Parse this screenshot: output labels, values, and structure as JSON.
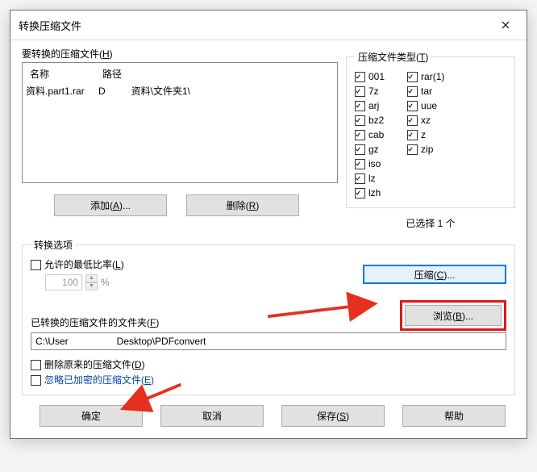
{
  "window": {
    "title": "转换压缩文件",
    "close_icon": "close"
  },
  "files": {
    "legend_pre": "要转换的压缩文件(",
    "legend_hot": "H",
    "legend_post": ")",
    "col_name": "名称",
    "col_path": "路径",
    "rows": [
      {
        "name": "资料.part1.rar",
        "path_pre": "D",
        "path_post": "资料\\文件夹1\\"
      }
    ],
    "add_pre": "添加(",
    "add_hot": "A",
    "add_post": ")...",
    "del_pre": "删除(",
    "del_hot": "R",
    "del_post": ")"
  },
  "types": {
    "legend_pre": "压缩文件类型(",
    "legend_hot": "T",
    "legend_post": ")",
    "col1": [
      "001",
      "7z",
      "arj",
      "bz2",
      "cab",
      "gz",
      "iso",
      "lz",
      "lzh"
    ],
    "col2": [
      "rar(1)",
      "tar",
      "uue",
      "xz",
      "z",
      "zip"
    ],
    "selected": "已选择 1 个"
  },
  "options": {
    "legend": "转换选项",
    "ratio_pre": "允许的最低比率(",
    "ratio_hot": "L",
    "ratio_post": ")",
    "ratio_value": "100",
    "ratio_suffix": "%",
    "compress_pre": "压缩(",
    "compress_hot": "C",
    "compress_post": ")...",
    "folder_pre": "已转换的压缩文件的文件夹(",
    "folder_hot": "F",
    "folder_post": ")",
    "folder_path_pre": "C:\\User",
    "folder_path_post": "Desktop\\PDFconvert",
    "browse_pre": "浏览(",
    "browse_hot": "B",
    "browse_post": ")...",
    "del_orig_pre": "删除原来的压缩文件(",
    "del_orig_hot": "D",
    "del_orig_post": ")",
    "skip_enc_pre": "忽略已加密的压缩文件(",
    "skip_enc_hot": "E",
    "skip_enc_post": ")"
  },
  "buttons": {
    "ok": "确定",
    "cancel": "取消",
    "save_pre": "保存(",
    "save_hot": "S",
    "save_post": ")",
    "help": "帮助"
  }
}
